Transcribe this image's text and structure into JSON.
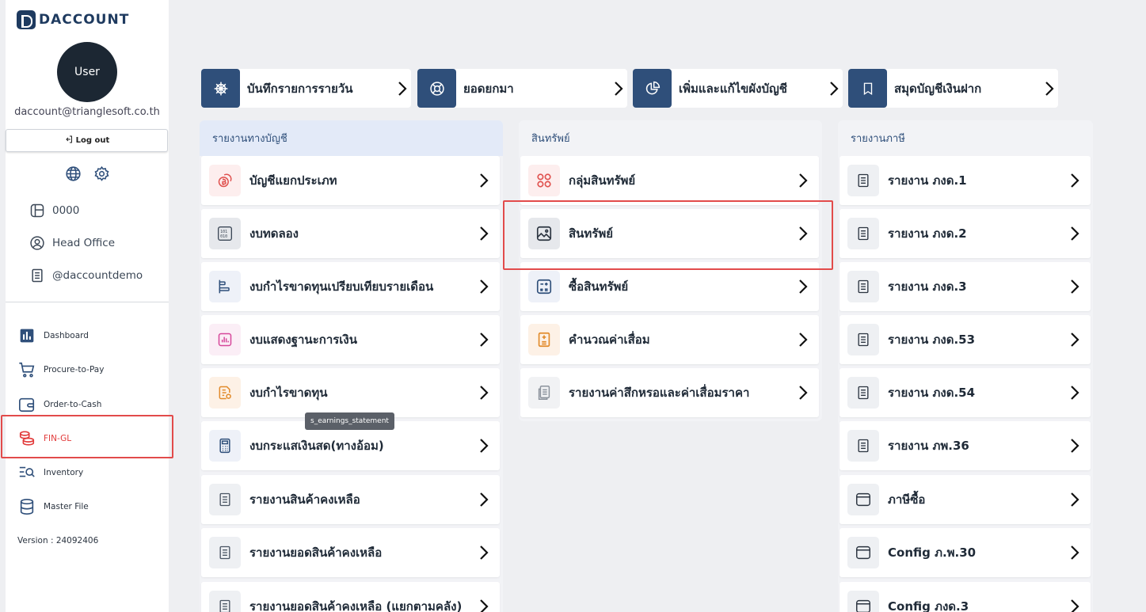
{
  "app": {
    "brand": "DACCOUNT"
  },
  "user": {
    "avatar_label": "User",
    "email": "daccount@trianglesoft.co.th",
    "logout_label": "Log out"
  },
  "info": [
    {
      "icon": "layout-icon",
      "label": "0000"
    },
    {
      "icon": "user-circle-icon",
      "label": "Head Office"
    },
    {
      "icon": "document-icon",
      "label": "@daccountdemo"
    }
  ],
  "nav": [
    {
      "icon": "bar-chart-icon",
      "label": "Dashboard",
      "active": false
    },
    {
      "icon": "cart-icon",
      "label": "Procure-to-Pay",
      "active": false
    },
    {
      "icon": "wallet-icon",
      "label": "Order-to-Cash",
      "active": false
    },
    {
      "icon": "coins-icon",
      "label": "FIN-GL",
      "active": true
    },
    {
      "icon": "list-search-icon",
      "label": "Inventory",
      "active": false
    },
    {
      "icon": "database-icon",
      "label": "Master File",
      "active": false
    }
  ],
  "version": "Version : 24092406",
  "quick": [
    {
      "icon": "ship-wheel-icon",
      "label": "บันทึกรายการรายวัน"
    },
    {
      "icon": "lifebuoy-icon",
      "label": "ยอดยกมา"
    },
    {
      "icon": "pie-chart-icon",
      "label": "เพิ่มและแก้ไขผังบัญชี"
    },
    {
      "icon": "bookmark-icon",
      "label": "สมุดบัญชีเงินฝาก"
    }
  ],
  "columns": [
    {
      "title": "รายงานทางบัญชี",
      "items": [
        {
          "icon": "coin-icon",
          "label": "บัญชีแยกประเภท"
        },
        {
          "icon": "binary-icon",
          "label": "งบทดลอง"
        },
        {
          "icon": "align-bars-icon",
          "label": "งบกำไรขาดทุนเปรียบเทียบรายเดือน"
        },
        {
          "icon": "chart-box-icon",
          "label": "งบแสดงฐานะการเงิน"
        },
        {
          "icon": "report-icon",
          "label": "งบกำไรขาดทุน"
        },
        {
          "icon": "calculator-icon",
          "label": "งบกระแสเงินสด(ทางอ้อม)"
        },
        {
          "icon": "document-icon",
          "label": "รายงานสินค้าคงเหลือ"
        },
        {
          "icon": "document-icon",
          "label": "รายงานยอดสินค้าคงเหลือ"
        },
        {
          "icon": "document-icon",
          "label": "รายงานยอดสินค้าคงเหลือ (แยกตามคลัง)"
        }
      ]
    },
    {
      "title": "สินทรัพย์",
      "items": [
        {
          "icon": "group-circles-icon",
          "label": "กลุ่มสินทรัพย์"
        },
        {
          "icon": "image-icon",
          "label": "สินทรัพย์"
        },
        {
          "icon": "calc-square-icon",
          "label": "ซื้อสินทรัพย์"
        },
        {
          "icon": "ledger-icon",
          "label": "คำนวณค่าเสื่อม"
        },
        {
          "icon": "pages-icon",
          "label": "รายงานค่าสึกหรอและค่าเสื่อมราคา"
        }
      ]
    },
    {
      "title": "รายงานภาษี",
      "items": [
        {
          "icon": "document-icon",
          "label": "รายงาน ภงด.1"
        },
        {
          "icon": "document-icon",
          "label": "รายงาน ภงด.2"
        },
        {
          "icon": "document-icon",
          "label": "รายงาน ภงด.3"
        },
        {
          "icon": "document-icon",
          "label": "รายงาน ภงด.53"
        },
        {
          "icon": "document-icon",
          "label": "รายงาน ภงด.54"
        },
        {
          "icon": "document-icon",
          "label": "รายงาน ภพ.36"
        },
        {
          "icon": "browser-icon",
          "label": "ภาษีซื้อ"
        },
        {
          "icon": "browser-icon",
          "label": "Config ภ.พ.30"
        },
        {
          "icon": "browser-icon",
          "label": "Config ภงด.3"
        }
      ]
    }
  ],
  "tooltip": "s_earnings_statement",
  "colors": {
    "primary": "#2f4f7a",
    "active": "#e23b3b",
    "highlight": "#e24b4b"
  }
}
